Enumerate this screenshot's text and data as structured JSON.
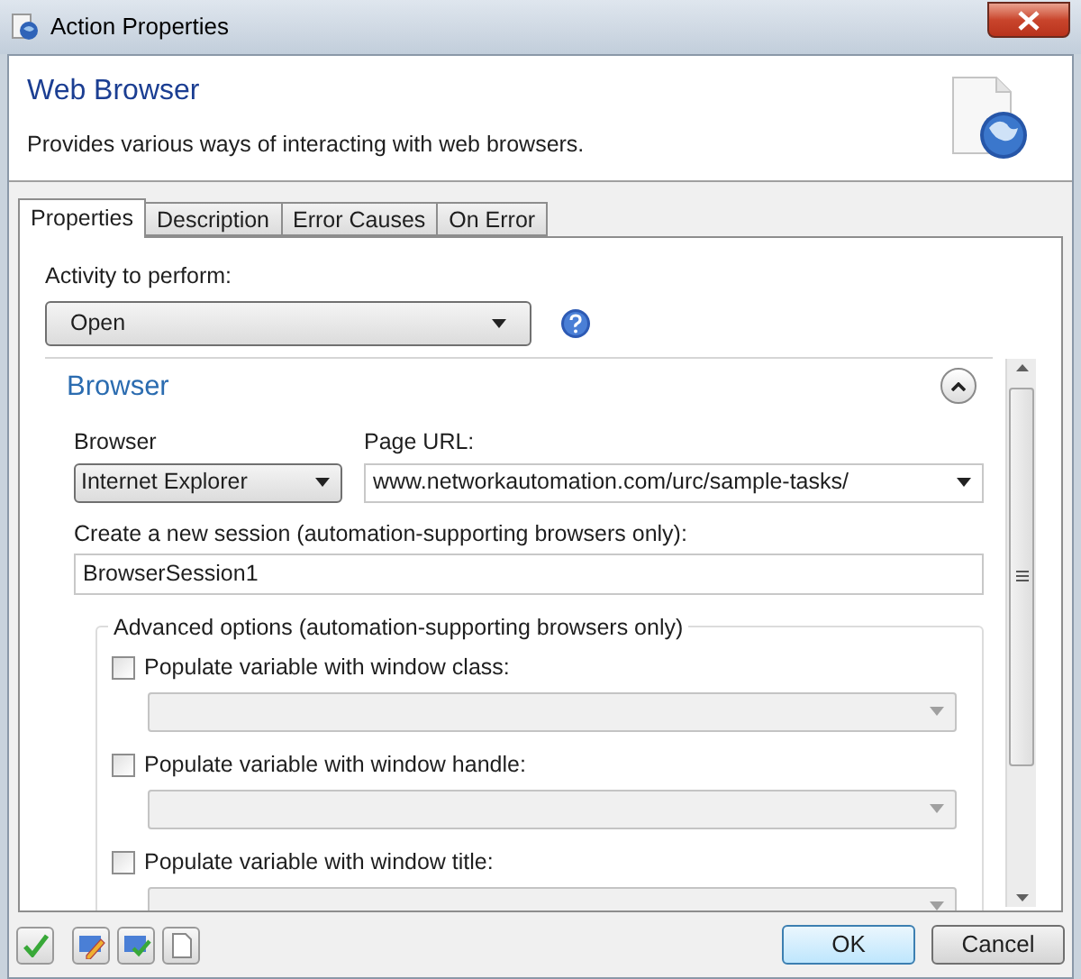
{
  "window": {
    "title": "Action Properties"
  },
  "header": {
    "title": "Web Browser",
    "description": "Provides various ways of interacting with web browsers."
  },
  "tabs": [
    {
      "label": "Properties",
      "selected": true
    },
    {
      "label": "Description",
      "selected": false
    },
    {
      "label": "Error Causes",
      "selected": false
    },
    {
      "label": "On Error",
      "selected": false
    }
  ],
  "activity": {
    "label": "Activity to perform:",
    "value": "Open"
  },
  "section": {
    "title": "Browser",
    "expanded": true,
    "browser": {
      "label": "Browser",
      "value": "Internet Explorer"
    },
    "page_url": {
      "label": "Page URL:",
      "value": "www.networkautomation.com/urc/sample-tasks/"
    },
    "session": {
      "label": "Create a new session (automation-supporting browsers only):",
      "value": "BrowserSession1"
    },
    "advanced": {
      "legend": "Advanced options (automation-supporting browsers only)",
      "options": [
        {
          "label": "Populate variable with window class:",
          "checked": false
        },
        {
          "label": "Populate variable with window handle:",
          "checked": false
        },
        {
          "label": "Populate variable with window title:",
          "checked": false
        }
      ]
    }
  },
  "buttons": [
    {
      "label": "OK",
      "default": true
    },
    {
      "label": "Cancel",
      "default": false
    }
  ]
}
